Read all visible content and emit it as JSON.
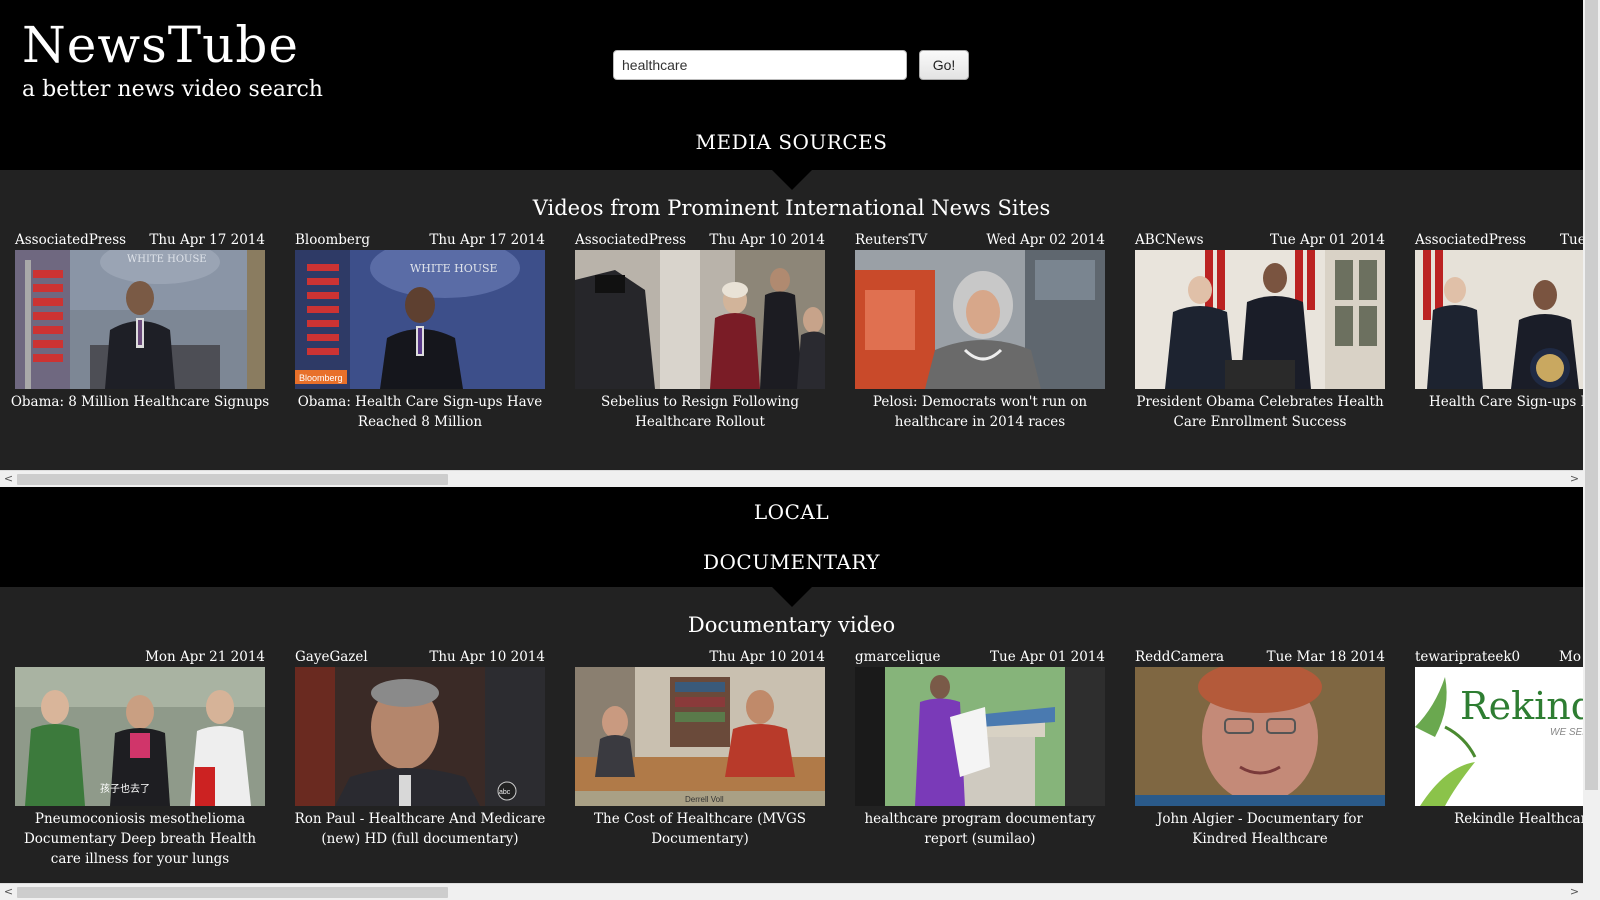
{
  "header": {
    "title": "NewsTube",
    "subtitle": "a better news video search"
  },
  "search": {
    "value": "healthcare",
    "button_label": "Go!"
  },
  "sections": {
    "media_sources": "MEDIA SOURCES",
    "local": "LOCAL",
    "documentary": "DOCUMENTARY"
  },
  "media_panel": {
    "title": "Videos from Prominent International News Sites",
    "videos": [
      {
        "source": "AssociatedPress",
        "date": "Thu Apr 17 2014",
        "title": "Obama: 8 Million Healthcare Signups"
      },
      {
        "source": "Bloomberg",
        "date": "Thu Apr 17 2014",
        "title": "Obama: Health Care Sign-ups Have Reached 8 Million"
      },
      {
        "source": "AssociatedPress",
        "date": "Thu Apr 10 2014",
        "title": "Sebelius to Resign Following Healthcare Rollout"
      },
      {
        "source": "ReutersTV",
        "date": "Wed Apr 02 2014",
        "title": "Pelosi: Democrats won't run on healthcare in 2014 races"
      },
      {
        "source": "ABCNews",
        "date": "Tue Apr 01 2014",
        "title": "President Obama Celebrates Health Care Enrollment Success"
      },
      {
        "source": "AssociatedPress",
        "date": "Tue",
        "title": "Health Care Sign-ups Re Million"
      }
    ]
  },
  "documentary_panel": {
    "title": "Documentary video",
    "videos": [
      {
        "source": "",
        "date": "Mon Apr 21 2014",
        "title": "Pneumoconiosis mesothelioma Documentary Deep breath Health care illness for your lungs"
      },
      {
        "source": "GayeGazel",
        "date": "Thu Apr 10 2014",
        "title": "Ron Paul - Healthcare And Medicare (new) HD (full documentary)"
      },
      {
        "source": "",
        "date": "Thu Apr 10 2014",
        "title": "The Cost of Healthcare (MVGS Documentary)"
      },
      {
        "source": "gmarcelique",
        "date": "Tue Apr 01 2014",
        "title": "healthcare program documentary report (sumilao)"
      },
      {
        "source": "ReddCamera",
        "date": "Tue Mar 18 2014",
        "title": "John Algier - Documentary for Kindred Healthcare"
      },
      {
        "source": "tewariprateek0",
        "date": "Mo",
        "title": "Rekindle Healthcare Doc"
      }
    ]
  },
  "thumbnail_text": {
    "white_house": "WHITE HOUSE",
    "bloomberg_badge": "Bloomberg",
    "derrell": "Derrell Voll",
    "rekindle": "Rekind",
    "rekindle_sub": "WE SER",
    "subtitle_cn": "孩子也去了",
    "abc_bug": "abc"
  },
  "scrollbars": {
    "left_arrow": "<",
    "right_arrow": ">"
  },
  "colors": {
    "page_bg": "#000000",
    "panel_bg": "#222222",
    "text": "#ffffff"
  }
}
